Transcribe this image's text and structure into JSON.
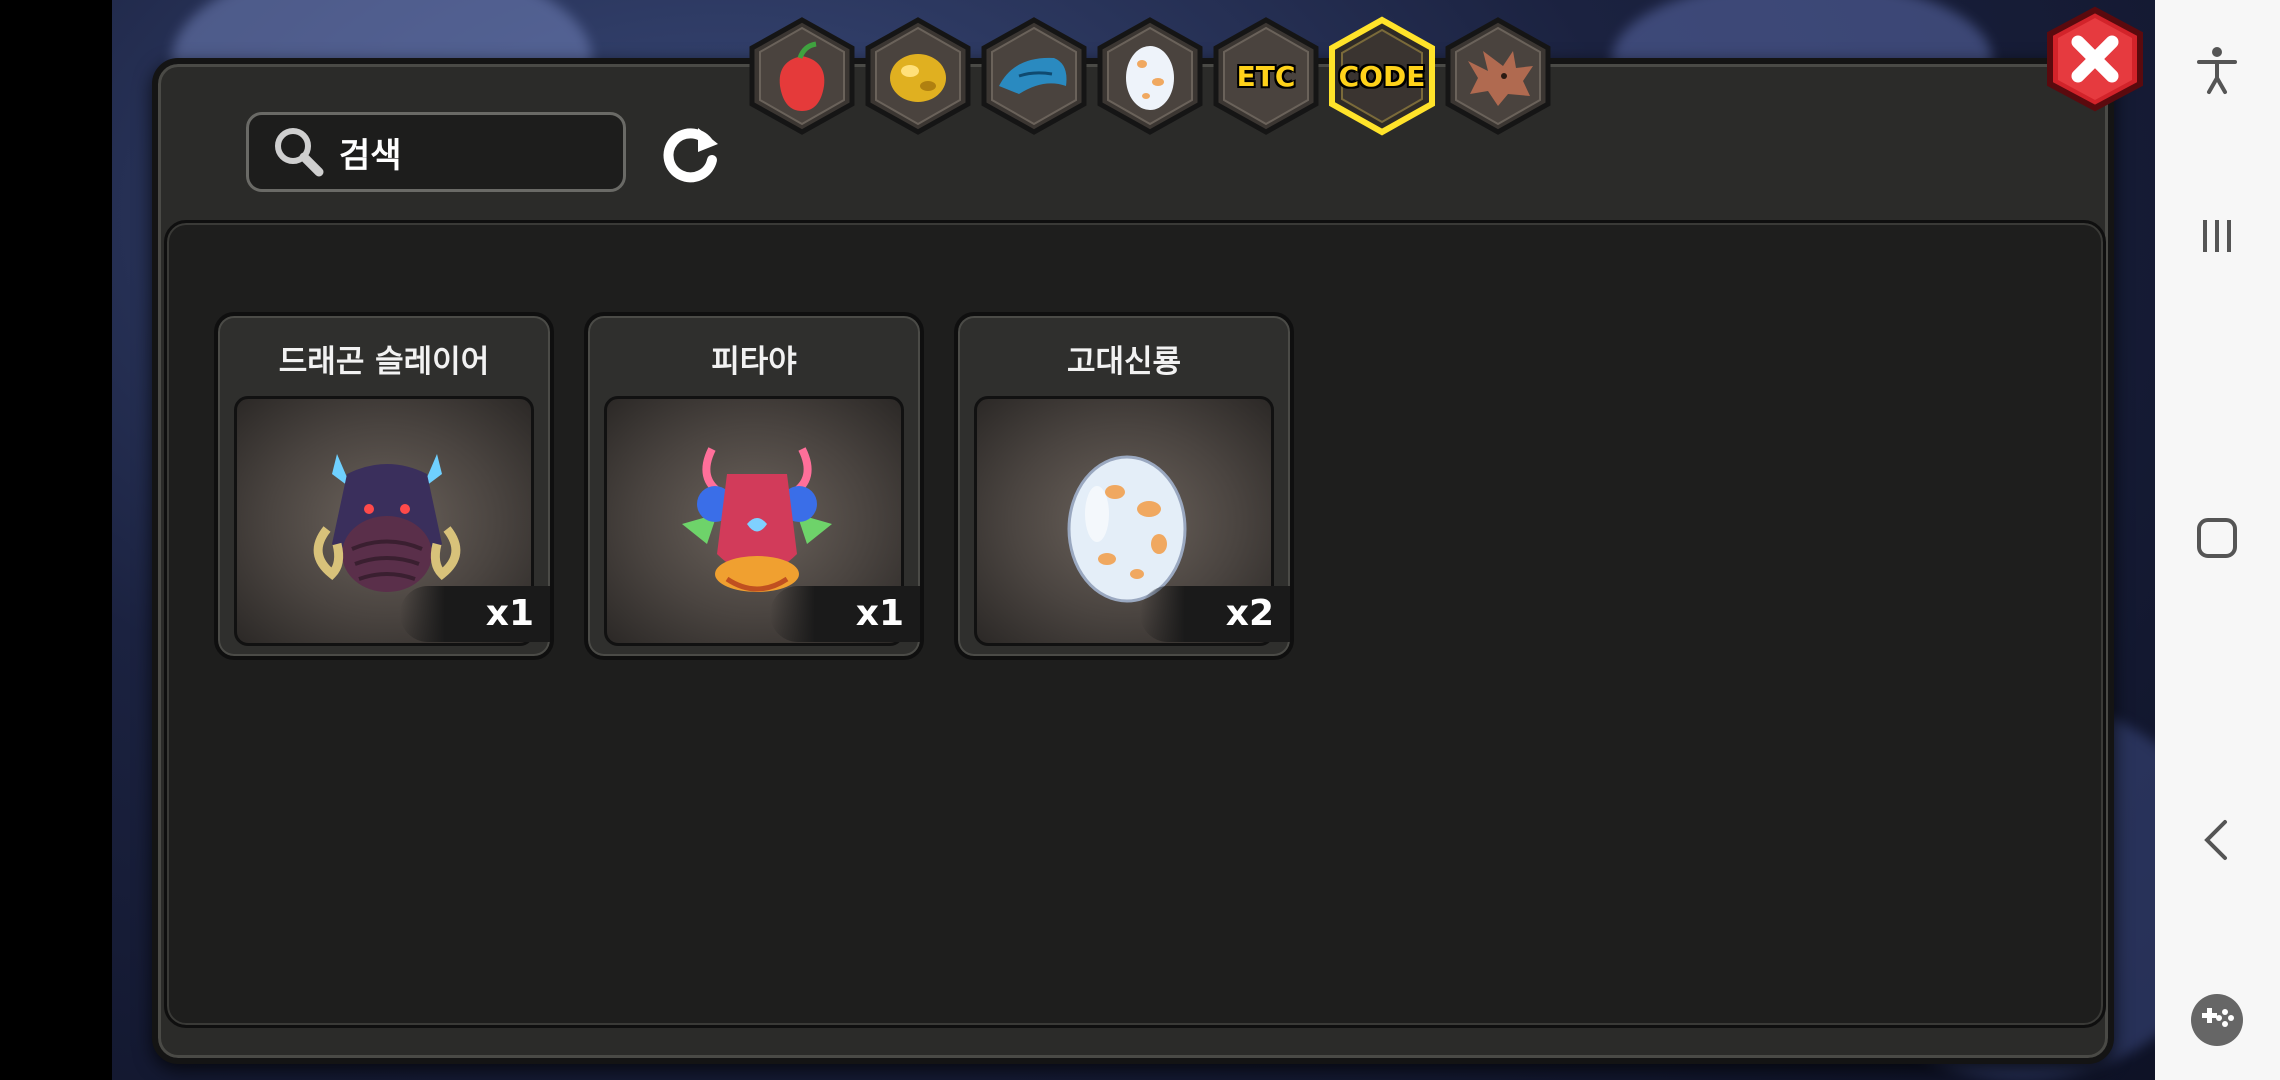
{
  "search": {
    "label": "검색"
  },
  "tabs": [
    {
      "id": "fruit",
      "icon": "fruit-icon",
      "label": ""
    },
    {
      "id": "gold",
      "icon": "gold-icon",
      "label": ""
    },
    {
      "id": "dragon-scale",
      "icon": "dragon-scale-icon",
      "label": ""
    },
    {
      "id": "egg",
      "icon": "egg-icon",
      "label": ""
    },
    {
      "id": "etc",
      "icon": "",
      "label": "ETC"
    },
    {
      "id": "code",
      "icon": "",
      "label": "CODE",
      "selected": true
    },
    {
      "id": "dragon",
      "icon": "dragon-head-icon",
      "label": ""
    }
  ],
  "items": [
    {
      "name": "드래곤 슬레이어",
      "count": "x1",
      "icon": "dark-dragon-icon"
    },
    {
      "name": "피타야",
      "count": "x1",
      "icon": "pitaya-dragon-icon"
    },
    {
      "name": "고대신룡",
      "count": "x2",
      "icon": "dragon-egg-icon"
    }
  ],
  "colors": {
    "accent": "#ffd21a",
    "close": "#d2232a",
    "panel": "#2b2b29"
  },
  "navbar": {
    "buttons": [
      "accessibility-icon",
      "recent-apps-icon",
      "home-icon",
      "back-icon",
      "game-tools-icon"
    ]
  }
}
